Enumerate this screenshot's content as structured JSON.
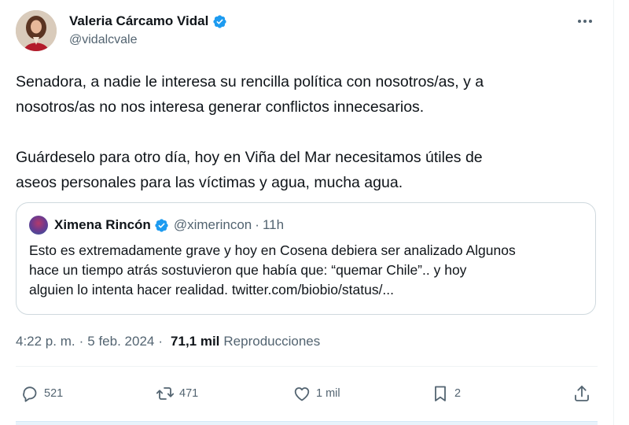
{
  "author": {
    "display_name": "Valeria Cárcamo Vidal",
    "handle": "@vidalcvale",
    "verified_icon": "verified-badge-icon"
  },
  "tweet": {
    "paragraph_1": "Senadora, a nadie le interesa su rencilla política con nosotros/as, y a\nnosotros/as no nos interesa generar conflictos innecesarios.",
    "paragraph_2": "Guárdeselo para otro día, hoy en Viña del Mar necesitamos útiles de\naseos personales para las víctimas y agua, mucha agua."
  },
  "quoted": {
    "display_name": "Ximena Rincón",
    "handle": "@ximerincon",
    "dot": "·",
    "time": "11h",
    "text": "Esto es extremadamente grave y hoy en Cosena debiera ser analizado Algunos\nhace un tiempo atrás sostuvieron que había que: “quemar Chile”.. y hoy\nalguien lo intenta hacer realidad. twitter.com/biobio/status/..."
  },
  "meta": {
    "time": "4:22 p. m.",
    "sep": "·",
    "date": "5 feb. 2024",
    "sep2": "·",
    "views_count": "71,1 mil",
    "views_label": "Reproducciones"
  },
  "actions": {
    "replies": "521",
    "reposts": "471",
    "likes": "1 mil",
    "bookmarks": "2"
  },
  "colors": {
    "verified": "#1d9bf0",
    "muted": "#536471",
    "text": "#0f1419"
  }
}
